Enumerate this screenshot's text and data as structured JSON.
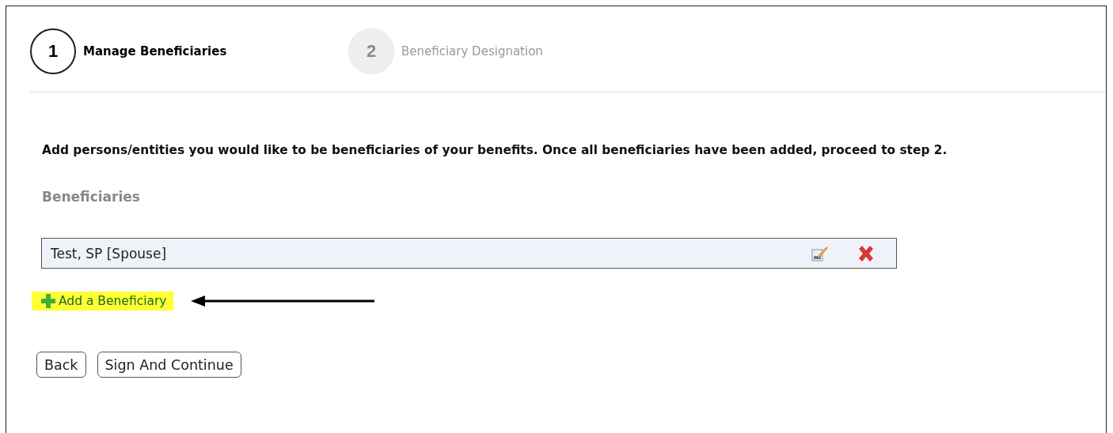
{
  "steps": [
    {
      "number": "1",
      "label": "Manage Beneficiaries",
      "selected": true
    },
    {
      "number": "2",
      "label": "Beneficiary Designation",
      "selected": false
    }
  ],
  "instruction": "Add persons/entities you would like to be beneficiaries of your benefits. Once all beneficiaries have been added, proceed to step 2.",
  "section_title": "Beneficiaries",
  "beneficiaries": [
    {
      "name": "Test, SP [Spouse]"
    }
  ],
  "add_link": {
    "label": "Add a Beneficiary",
    "highlighted": true
  },
  "buttons": [
    "Back",
    "Sign And Continue"
  ]
}
